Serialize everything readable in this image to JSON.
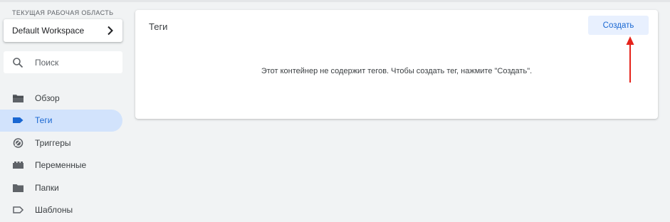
{
  "sidebar": {
    "workspace_caption": "ТЕКУЩАЯ РАБОЧАЯ ОБЛАСТЬ",
    "workspace_name": "Default Workspace",
    "search_placeholder": "Поиск",
    "items": [
      {
        "label": "Обзор",
        "icon": "folder-overview-icon",
        "active": false
      },
      {
        "label": "Теги",
        "icon": "tag-icon",
        "active": true
      },
      {
        "label": "Триггеры",
        "icon": "trigger-icon",
        "active": false
      },
      {
        "label": "Переменные",
        "icon": "variables-icon",
        "active": false
      },
      {
        "label": "Папки",
        "icon": "folder-icon",
        "active": false
      },
      {
        "label": "Шаблоны",
        "icon": "template-icon",
        "active": false
      }
    ]
  },
  "main": {
    "title": "Теги",
    "create_label": "Создать",
    "empty_message": "Этот контейнер не содержит тегов. Чтобы создать тег, нажмите \"Создать\"."
  },
  "colors": {
    "accent": "#1967d2",
    "active_bg": "#d2e3fc",
    "button_bg": "#e8f0fe",
    "annotation_arrow": "#e5231b"
  }
}
